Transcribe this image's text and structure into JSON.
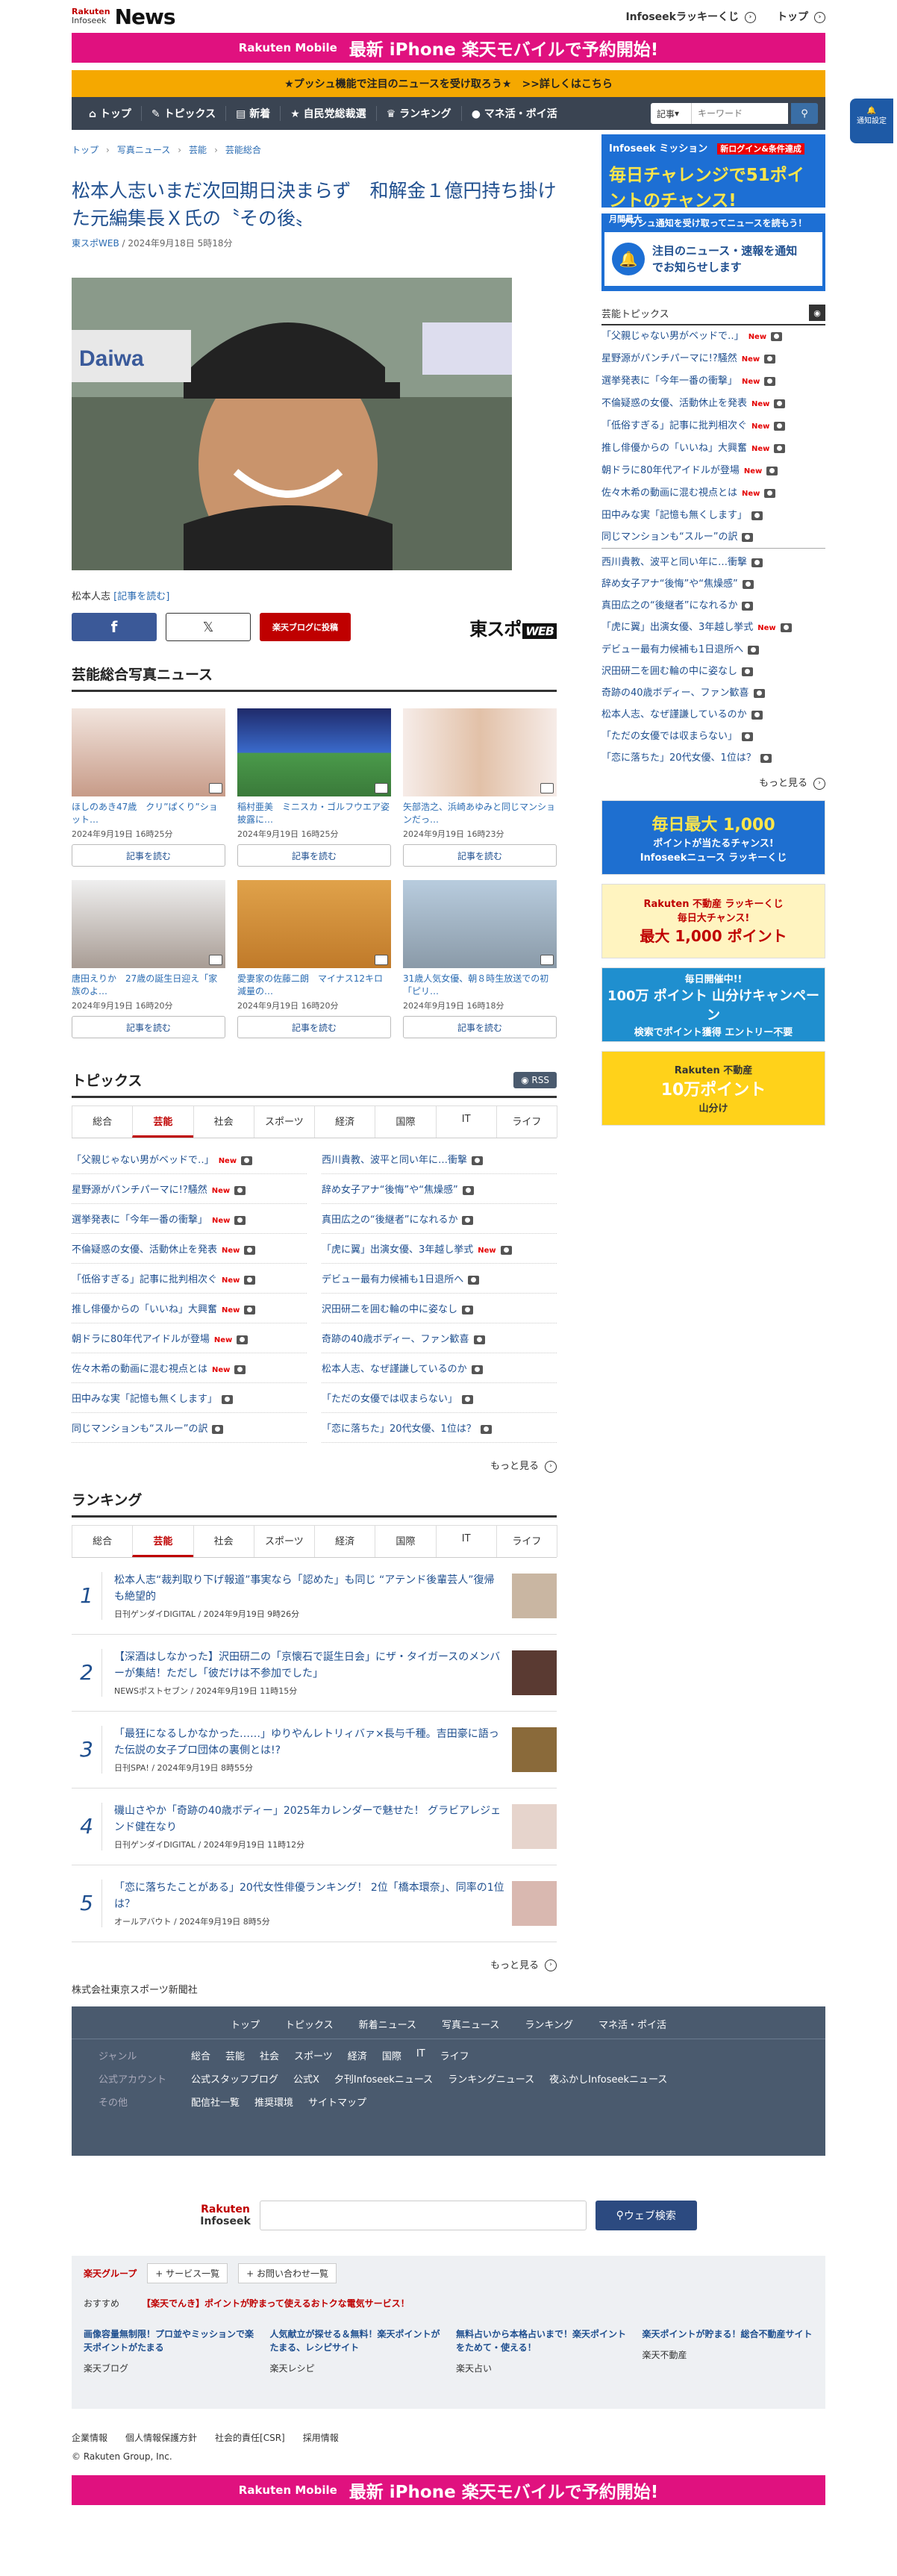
{
  "header": {
    "logo_rakuten": "Rakuten",
    "logo_infoseek": "Infoseek",
    "logo_news": "News",
    "link_kuji": "Infoseekラッキーくじ",
    "link_top": "トップ"
  },
  "banner": {
    "rakuten_mobile": "Rakuten Mobile",
    "headline_a": "最新",
    "headline_b": "iPhone",
    "headline_c": "楽天モバイルで予約開始!"
  },
  "push_bar": "★プッシュ機能で注目のニュースを受け取ろう★　>>詳しくはこちら",
  "nav": {
    "items": [
      "トップ",
      "トピックス",
      "新着",
      "自民党総裁選",
      "ランキング",
      "マネ活・ポイ活"
    ],
    "search_select": "記事",
    "search_placeholder": "キーワード"
  },
  "notify_button": "通知設定",
  "breadcrumb": [
    "トップ",
    "写真ニュース",
    "芸能",
    "芸能総合"
  ],
  "article": {
    "title": "松本人志いまだ次回期日決まらず　和解金１億円持ち掛けた元編集長Ｘ氏の〝その後〟",
    "source": "東スポWEB",
    "date": " / 2024年9月18日 5時18分",
    "caption_name": "松本人志",
    "caption_link": "[記事を読む]",
    "share_blog": "楽天ブログに投稿",
    "publisher_logo": "東スポ",
    "publisher_logo_suffix": "WEB"
  },
  "photo_news": {
    "heading": "芸能総合写真ニュース",
    "read_label": "記事を読む",
    "items": [
      {
        "title": "ほしのあき47歳　クリ”ぱくり”ショット…",
        "date": "2024年9月19日 16時25分"
      },
      {
        "title": "稲村亜美　ミニスカ・ゴルフウエア姿披露に…",
        "date": "2024年9月19日 16時25分"
      },
      {
        "title": "矢部浩之、浜崎あゆみと同じマンションだっ…",
        "date": "2024年9月19日 16時23分"
      },
      {
        "title": "唐田えりか　27歳の誕生日迎え「家族のよ…",
        "date": "2024年9月19日 16時20分"
      },
      {
        "title": "愛妻家の佐藤二朗　マイナス12キロ減量の…",
        "date": "2024年9月19日 16時20分"
      },
      {
        "title": "31歳人気女優、朝８時生放送での初「ピリ…",
        "date": "2024年9月19日 16時18分"
      }
    ]
  },
  "topics": {
    "heading": "トピックス",
    "rss": "RSS",
    "tabs": [
      "総合",
      "芸能",
      "社会",
      "スポーツ",
      "経済",
      "国際",
      "IT",
      "ライフ"
    ],
    "new_label": "New",
    "items": [
      {
        "text": "「父親じゃない男がベッドで‥」",
        "new": true
      },
      {
        "text": "西川貴教、波平と同い年に…衝撃",
        "new": false
      },
      {
        "text": "星野源がパンチパーマに!?騒然",
        "new": true
      },
      {
        "text": "辞め女子アナ“後悔”や“焦燥感”",
        "new": false
      },
      {
        "text": "選挙発表に「今年一番の衝撃」",
        "new": true
      },
      {
        "text": "真田広之の“後継者”になれるか",
        "new": false
      },
      {
        "text": "不倫疑惑の女優、活動休止を発表",
        "new": true
      },
      {
        "text": "「虎に翼」出演女優、3年越し挙式",
        "new": true
      },
      {
        "text": "「低俗すぎる」記事に批判相次ぐ",
        "new": true
      },
      {
        "text": "デビュー最有力候補も1日退所へ",
        "new": false
      },
      {
        "text": "推し俳優からの「いいね」大興奮",
        "new": true
      },
      {
        "text": "沢田研二を囲む輪の中に姿なし",
        "new": false
      },
      {
        "text": "朝ドラに80年代アイドルが登場",
        "new": true
      },
      {
        "text": "奇跡の40歳ボディー、ファン歓喜",
        "new": false
      },
      {
        "text": "佐々木希の動画に混む視点とは",
        "new": true
      },
      {
        "text": "松本人志、なぜ謹謙しているのか",
        "new": false
      },
      {
        "text": "田中みな実「記憶も無くします」",
        "new": false
      },
      {
        "text": "「ただの女優では収まらない」",
        "new": false
      },
      {
        "text": "同じマンションも“スルー”の訳",
        "new": false
      },
      {
        "text": "「恋に落ちた」20代女優、1位は？",
        "new": false
      }
    ],
    "more": "もっと見る"
  },
  "ranking": {
    "heading": "ランキング",
    "tabs": [
      "総合",
      "芸能",
      "社会",
      "スポーツ",
      "経済",
      "国際",
      "IT",
      "ライフ"
    ],
    "items": [
      {
        "no": "1",
        "title": "松本人志“裁判取り下げ報道”事実なら「認めた」も同じ “アテンド後輩芸人”復帰も絶望的",
        "source": "日刊ゲンダイDIGITAL / 2024年9月19日 9時26分"
      },
      {
        "no": "2",
        "title": "【深酒はしなかった】沢田研二の「京懐石で誕生日会」にザ・タイガースのメンバーが集結！ただし「彼だけは不参加でした」",
        "source": "NEWSポストセブン / 2024年9月19日 11時15分"
      },
      {
        "no": "3",
        "title": "「最狂になるしかなかった……」ゆりやんレトリィバァ×長与千種。吉田豪に語った伝説の女子プロ団体の裏側とは!?",
        "source": "日刊SPA! / 2024年9月19日 8時55分"
      },
      {
        "no": "4",
        "title": "磯山さやか「奇跡の40歳ボディー」2025年カレンダーで魅せた！ グラビアレジェンド健在なり",
        "source": "日刊ゲンダイDIGITAL / 2024年9月19日 11時12分"
      },
      {
        "no": "5",
        "title": "「恋に落ちたことがある」20代女性俳優ランキング！ 2位「橋本環奈」、同率の1位は？",
        "source": "オールアバウト / 2024年9月19日 8時5分"
      }
    ],
    "more": "もっと見る"
  },
  "corp": "株式会社東京スポーツ新聞社",
  "sidebar": {
    "mission_label": "Infoseek ミッション",
    "mission_sub": "新ログイン&条件達成",
    "mission_text": "毎日チャレンジで51ポイントのチャンス!",
    "mission_badge": "月間最大",
    "push_head": "プッシュ通知を受け取ってニュースを読もう！",
    "push_body": "注目のニュース・速報を通知でお知らせします",
    "topics_heading": "芸能トピックス",
    "items": [
      {
        "text": "「父親じゃない男がベッドで‥」",
        "new": true
      },
      {
        "text": "星野源がパンチパーマに!?騒然",
        "new": true
      },
      {
        "text": "選挙発表に「今年一番の衝撃」",
        "new": true
      },
      {
        "text": "不倫疑惑の女優、活動休止を発表",
        "new": true
      },
      {
        "text": "「低俗すぎる」記事に批判相次ぐ",
        "new": true
      },
      {
        "text": "推し俳優からの「いいね」大興奮",
        "new": true
      },
      {
        "text": "朝ドラに80年代アイドルが登場",
        "new": true
      },
      {
        "text": "佐々木希の動画に混む視点とは",
        "new": true
      },
      {
        "text": "田中みな実「記憶も無くします」",
        "new": false
      },
      {
        "text": "同じマンションも“スルー”の訳",
        "new": false
      },
      {
        "text": "西川貴教、波平と同い年に…衝撃",
        "new": false
      },
      {
        "text": "辞め女子アナ“後悔”や“焦燥感”",
        "new": false
      },
      {
        "text": "真田広之の“後継者”になれるか",
        "new": false
      },
      {
        "text": "「虎に翼」出演女優、3年越し挙式",
        "new": true
      },
      {
        "text": "デビュー最有力候補も1日退所へ",
        "new": false
      },
      {
        "text": "沢田研二を囲む輪の中に姿なし",
        "new": false
      },
      {
        "text": "奇跡の40歳ボディー、ファン歓喜",
        "new": false
      },
      {
        "text": "松本人志、なぜ謹謙しているのか",
        "new": false
      },
      {
        "text": "「ただの女優では収まらない」",
        "new": false
      },
      {
        "text": "「恋に落ちた」20代女優、1位は？",
        "new": false
      }
    ],
    "more": "もっと見る",
    "ads": [
      {
        "a": "毎日最大 1,000",
        "b": "ポイントが当たるチャンス!",
        "c": "Infoseekニュース ラッキーくじ"
      },
      {
        "a": "Rakuten 不動産 ラッキーくじ",
        "b": "毎日大チャンス!",
        "c": "最大 1,000 ポイント"
      },
      {
        "a": "毎日開催中!!",
        "b": "100万 ポイント 山分けキャンペーン",
        "c": "検索でポイント獲得 エントリー不要"
      },
      {
        "a": "Rakuten 不動産",
        "b": "10万ポイント",
        "c": "山分け"
      }
    ]
  },
  "footer": {
    "nav": [
      "トップ",
      "トピックス",
      "新着ニュース",
      "写真ニュース",
      "ランキング",
      "マネ活・ポイ活"
    ],
    "rows": [
      {
        "key": "ジャンル",
        "items": [
          "総合",
          "芸能",
          "社会",
          "スポーツ",
          "経済",
          "国際",
          "IT",
          "ライフ"
        ]
      },
      {
        "key": "公式アカウント",
        "items": [
          "公式スタッフブログ",
          "公式X",
          "夕刊Infoseekニュース",
          "ランキングニュース",
          "夜ふかしInfoseekニュース"
        ]
      },
      {
        "key": "その他",
        "items": [
          "配信社一覧",
          "推奨環境",
          "サイトマップ"
        ]
      }
    ],
    "search_button": "ウェブ検索",
    "group_label": "楽天グループ",
    "service_list": "サービス一覧",
    "inquiry": "お問い合わせ一覧",
    "osusume": "おすすめ",
    "osusume_text": "【楽天でんき】ポイントが貯まって使えるおトクな電気サービス！",
    "promos": [
      {
        "t": "画像容量無制限！プロ並やミッションで楽天ポイントがたまる",
        "s": "楽天ブログ"
      },
      {
        "t": "人気献立が探せる＆無料！楽天ポイントがたまる、レシピサイト",
        "s": "楽天レシピ"
      },
      {
        "t": "無料占いから本格占いまで！楽天ポイントをためて・使える！",
        "s": "楽天占い"
      },
      {
        "t": "楽天ポイントが貯まる！総合不動産サイト",
        "s": "楽天不動産"
      }
    ],
    "links": [
      "企業情報",
      "個人情報保護方針",
      "社会的責任[CSR]",
      "採用情報"
    ],
    "copyright": "© Rakuten Group, Inc."
  }
}
